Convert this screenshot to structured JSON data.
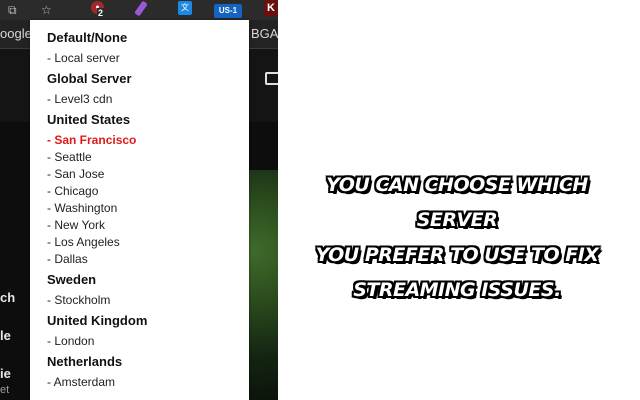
{
  "toolbar": {
    "badge_count": "2",
    "vpn_region_badge": "US-1",
    "translate_icon_glyph": "文",
    "k_icon_letter": "K"
  },
  "bookmarks": {
    "left_text": "oogle",
    "right_text": "BGA"
  },
  "side_fragments": [
    "ch",
    "le",
    "ie",
    "et"
  ],
  "menu": {
    "groups": [
      {
        "title": "Default/None",
        "items": [
          "Local server"
        ]
      },
      {
        "title": "Global Server",
        "items": [
          "Level3 cdn"
        ]
      },
      {
        "title": "United States",
        "items": [
          "San Francisco",
          "Seattle",
          "San Jose",
          "Chicago",
          "Washington",
          "New York",
          "Los Angeles",
          "Dallas"
        ]
      },
      {
        "title": "Sweden",
        "items": [
          "Stockholm"
        ]
      },
      {
        "title": "United Kingdom",
        "items": [
          "London"
        ]
      },
      {
        "title": "Netherlands",
        "items": [
          "Amsterdam"
        ]
      }
    ],
    "selected_item": "San Francisco",
    "selected_color": "#e01b1b",
    "item_prefix": "- "
  },
  "caption": {
    "lines": [
      "You can choose which server",
      "you prefer to use to fix",
      "streaming issues."
    ]
  }
}
